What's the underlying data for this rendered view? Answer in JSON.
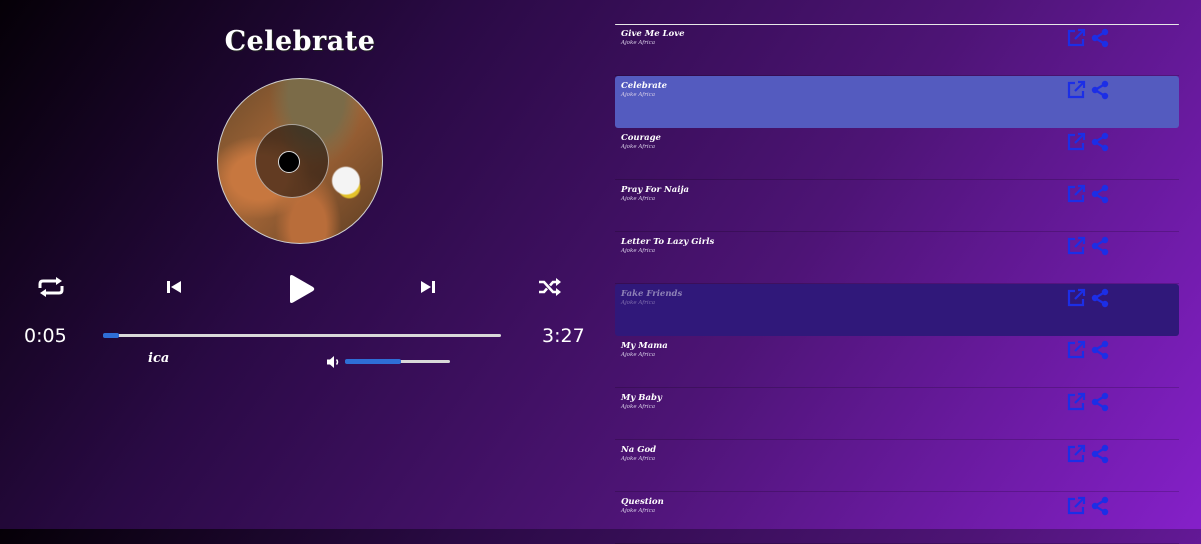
{
  "now_playing": {
    "title": "Celebrate",
    "artist_fragment": "ica",
    "time_current": "0:05",
    "time_total": "3:27",
    "progress_fraction": 0.04,
    "volume_fraction": 0.53
  },
  "controls": {
    "icons": [
      "repeat-icon",
      "previous-icon",
      "play-icon",
      "next-icon",
      "shuffle-icon"
    ]
  },
  "colors": {
    "accent": "#2e6ed6",
    "active_row": "#545bbf",
    "icon_blue": "#1c2ee6"
  },
  "playlist": [
    {
      "name": "Give Me Love",
      "artist": "Ajoke Africa",
      "state": "normal"
    },
    {
      "name": "Celebrate",
      "artist": "Ajoke Africa",
      "state": "active"
    },
    {
      "name": "Courage",
      "artist": "Ajoke Africa",
      "state": "normal"
    },
    {
      "name": "Pray For Naija",
      "artist": "Ajoke Africa",
      "state": "normal"
    },
    {
      "name": "Letter To Lazy Girls",
      "artist": "Ajoke Africa",
      "state": "normal"
    },
    {
      "name": "Fake Friends",
      "artist": "Ajoke Africa",
      "state": "dim"
    },
    {
      "name": "My Mama",
      "artist": "Ajoke Africa",
      "state": "normal"
    },
    {
      "name": "My Baby",
      "artist": "Ajoke Africa",
      "state": "normal"
    },
    {
      "name": "Na God",
      "artist": "Ajoke Africa",
      "state": "normal"
    },
    {
      "name": "Question",
      "artist": "Ajoke Africa",
      "state": "normal"
    }
  ]
}
